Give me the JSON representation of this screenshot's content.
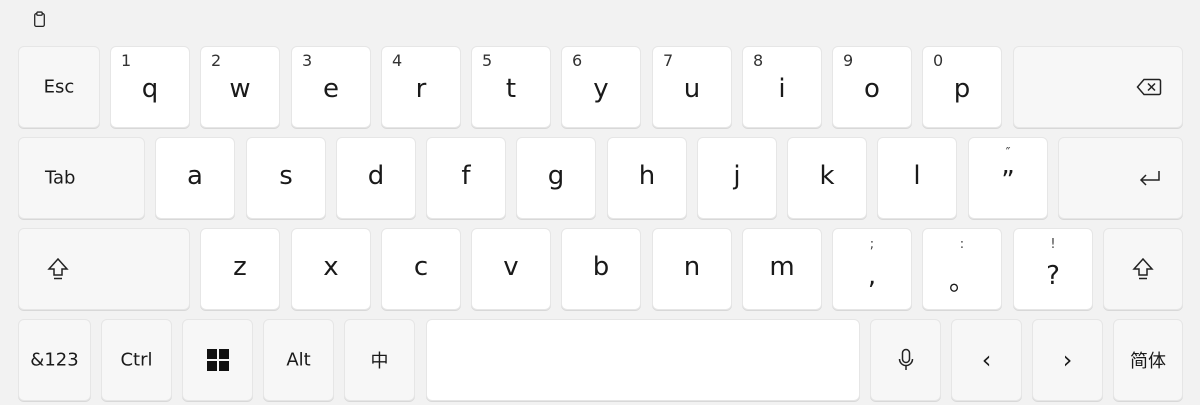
{
  "toolbar": {
    "clipboard_icon": "clipboard-icon"
  },
  "row1": {
    "esc": "Esc",
    "letters": [
      {
        "sup": "1",
        "main": "q"
      },
      {
        "sup": "2",
        "main": "w"
      },
      {
        "sup": "3",
        "main": "e"
      },
      {
        "sup": "4",
        "main": "r"
      },
      {
        "sup": "5",
        "main": "t"
      },
      {
        "sup": "6",
        "main": "y"
      },
      {
        "sup": "7",
        "main": "u"
      },
      {
        "sup": "8",
        "main": "i"
      },
      {
        "sup": "9",
        "main": "o"
      },
      {
        "sup": "0",
        "main": "p"
      }
    ],
    "backspace_icon": "backspace-icon"
  },
  "row2": {
    "tab": "Tab",
    "letters": [
      "a",
      "s",
      "d",
      "f",
      "g",
      "h",
      "j",
      "k",
      "l"
    ],
    "quote": {
      "sup": "″",
      "main": "”"
    },
    "enter_icon": "enter-icon"
  },
  "row3": {
    "shift_icon": "shift-icon",
    "letters": [
      "z",
      "x",
      "c",
      "v",
      "b",
      "n",
      "m"
    ],
    "punct": [
      {
        "sup": ";",
        "main": ","
      },
      {
        "sup": ":",
        "main": "。"
      },
      {
        "sup": "!",
        "main": "?"
      }
    ]
  },
  "row4": {
    "symbols": "&123",
    "ctrl": "Ctrl",
    "windows_icon": "windows-icon",
    "alt": "Alt",
    "ime": "中",
    "space": "",
    "mic_icon": "microphone-icon",
    "left_arrow": "‹",
    "right_arrow": "›",
    "lang": "简体"
  },
  "colors": {
    "background": "#f2f2f2",
    "key": "#ffffff",
    "text": "#1a1a1a"
  }
}
